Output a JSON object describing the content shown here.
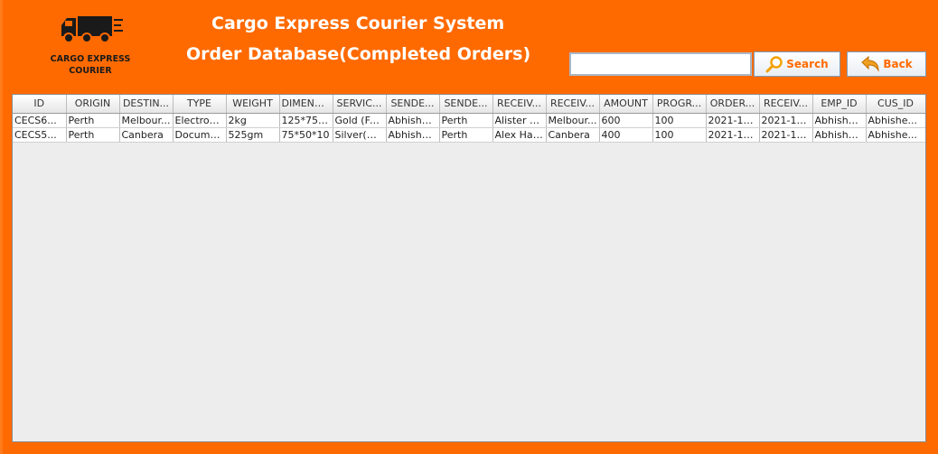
{
  "header": {
    "logo_line1": "CARGO EXPRESS",
    "logo_line2": "COURIER",
    "title_line1": "Cargo Express Courier System",
    "title_line2": "Order Database(Completed Orders)"
  },
  "toolbar": {
    "search_value": "",
    "search_label": "Search",
    "back_label": "Back"
  },
  "table": {
    "columns": [
      "ID",
      "ORIGIN",
      "DESTIN...",
      "TYPE",
      "WEIGHT",
      "DIMENSI...",
      "SERVIC...",
      "SENDE...",
      "SENDE...",
      "RECEIV...",
      "RECEIV...",
      "AMOUNT",
      "PROGR...",
      "ORDER...",
      "RECEIV...",
      "EMP_ID",
      "CUS_ID"
    ],
    "rows": [
      [
        "CECS6...",
        "Perth",
        "Melbour...",
        "Electron...",
        "2kg",
        "125*75*...",
        "Gold (Fa...",
        "Abhishe...",
        "Perth",
        "Alister C...",
        "Melbour...",
        "600",
        "100",
        "2021-11...",
        "2021-11...",
        "Abhishe...",
        "Abhishe..."
      ],
      [
        "CECS5...",
        "Perth",
        "Canbera",
        "Docume...",
        "525gm",
        "75*50*10",
        "Silver(M...",
        "Abhishe...",
        "Perth",
        "Alex Hal...",
        "Canbera",
        "400",
        "100",
        "2021-11...",
        "2021-11...",
        "Abhishe...",
        "Abhishe..."
      ]
    ]
  },
  "colors": {
    "background": "#ff6a00",
    "title_text": "#ffffff",
    "button_text": "#ff6a00"
  },
  "icons": {
    "logo": "truck-icon",
    "search": "search-icon",
    "back": "back-arrow-icon"
  }
}
